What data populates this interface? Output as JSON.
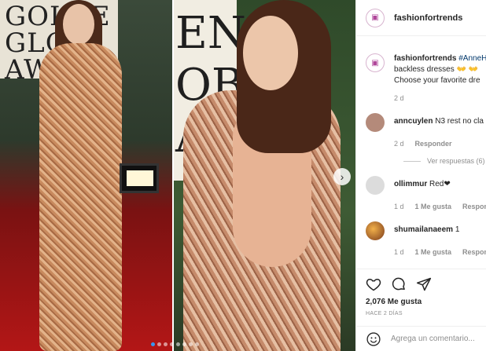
{
  "post": {
    "username": "fashionfortrends",
    "avatar_text": "▣"
  },
  "media": {
    "left_banner_text": "GOLDEN GLOBE AWARDS",
    "left_banner_lines": [
      "GOLDE",
      "GLO",
      "AWA"
    ],
    "right_banner_lines": [
      "EN",
      "OBE",
      "ARD"
    ],
    "next_icon": "chevron-right",
    "slide_count": 8,
    "active_slide": 0
  },
  "caption": {
    "username": "fashionfortrends",
    "hashtag": "#AnneH",
    "line2": "backless dresses 👐 👐",
    "line3": "Choose your favorite dre",
    "age": "2 d"
  },
  "comments": [
    {
      "user": "anncuylen",
      "text": "N3 rest no cla",
      "age": "2 d",
      "reply_label": "Responder",
      "avatar_color": "#b48a7a",
      "view_replies": "Ver respuestas (6)"
    },
    {
      "user": "ollimmur",
      "text": "Red❤",
      "age": "1 d",
      "likes": "1 Me gusta",
      "reply_label": "Responde",
      "avatar_color": "#dcdcdc"
    },
    {
      "user": "shumailanaeem",
      "text": "1",
      "age": "1 d",
      "likes": "1 Me gusta",
      "reply_label": "Responde",
      "avatar_color": "#c46a2a"
    }
  ],
  "actions": {
    "likes": "2,076 Me gusta",
    "time": "HACE 2 DÍAS"
  },
  "comment_box": {
    "placeholder": "Agrega un comentario..."
  }
}
